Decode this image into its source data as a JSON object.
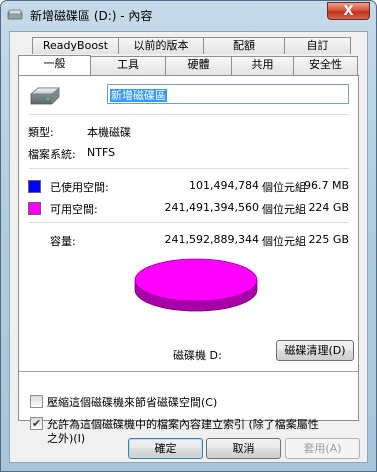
{
  "window": {
    "title": "新增磁碟區 (D:) - 內容",
    "close_glyph": "X"
  },
  "tabs": {
    "row1": [
      "ReadyBoost",
      "以前的版本",
      "配額",
      "自訂"
    ],
    "row2": [
      "一般",
      "工具",
      "硬體",
      "共用",
      "安全性"
    ],
    "selected": "一般"
  },
  "general": {
    "volume_name": "新增磁碟區",
    "type_label": "類型:",
    "type_value": "本機磁碟",
    "fs_label": "檔案系統:",
    "fs_value": "NTFS",
    "used": {
      "label": "已使用空間:",
      "bytes": "101,494,784",
      "unit": "個位元組",
      "human": "96.7 MB",
      "color": "#0000ff"
    },
    "free": {
      "label": "可用空間:",
      "bytes": "241,491,394,560",
      "unit": "個位元組",
      "human": "224 GB",
      "color": "#ff00ff"
    },
    "capacity": {
      "label": "容量:",
      "bytes": "241,592,889,344",
      "unit": "個位元組",
      "human": "225 GB"
    },
    "pie_fraction_used": 0.0004,
    "drive_label": "磁碟機 D:",
    "cleanup_button": "磁碟清理(D)",
    "compress_checkbox": {
      "label": "壓縮這個磁碟機來節省磁碟空間(C)",
      "checked": false
    },
    "index_checkbox": {
      "label_line1": "允許為這個磁碟機中的檔案內容建立索引 (除了檔案屬性",
      "label_line2": "之外)(I)",
      "checked": true
    }
  },
  "footer": {
    "ok": "確定",
    "cancel": "取消",
    "apply": "套用(A)"
  },
  "icons": {
    "title": "drive-icon",
    "drive": "hard-drive-icon",
    "close": "close-icon"
  }
}
